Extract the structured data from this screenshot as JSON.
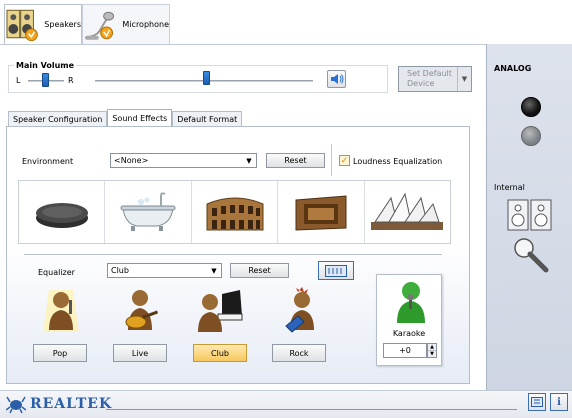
{
  "device_tabs": [
    {
      "label": "Speakers",
      "icon": "speakers-icon",
      "active": true
    },
    {
      "label": "Microphone",
      "icon": "microphone-icon",
      "active": false
    }
  ],
  "main_volume": {
    "title": "Main Volume",
    "left_label": "L",
    "right_label": "R",
    "balance": 0.5,
    "level": 0.5
  },
  "set_default": {
    "line1": "Set Default",
    "line2": "Device"
  },
  "tabs": [
    {
      "label": "Speaker Configuration",
      "active": false
    },
    {
      "label": "Sound Effects",
      "active": true
    },
    {
      "label": "Default Format",
      "active": false
    }
  ],
  "environment": {
    "label": "Environment",
    "value": "<None>",
    "reset_label": "Reset",
    "loudness_label": "Loudness Equalization",
    "loudness_checked": true,
    "presets": [
      "stone-disc",
      "bathtub",
      "colosseum",
      "cave-room",
      "opera-house"
    ]
  },
  "equalizer": {
    "label": "Equalizer",
    "value": "Club",
    "reset_label": "Reset",
    "presets": [
      {
        "label": "Pop",
        "active": false
      },
      {
        "label": "Live",
        "active": false
      },
      {
        "label": "Club",
        "active": true
      },
      {
        "label": "Rock",
        "active": false
      }
    ]
  },
  "karaoke": {
    "label": "Karaoke",
    "value": "+0"
  },
  "right_panel": {
    "analog_label": "ANALOG",
    "internal_label": "Internal"
  },
  "brand": {
    "name": "REALTEK"
  },
  "colors": {
    "accent": "#2a6fd1",
    "active_preset": "#f7c860",
    "right_bg": "#d6dce7"
  }
}
